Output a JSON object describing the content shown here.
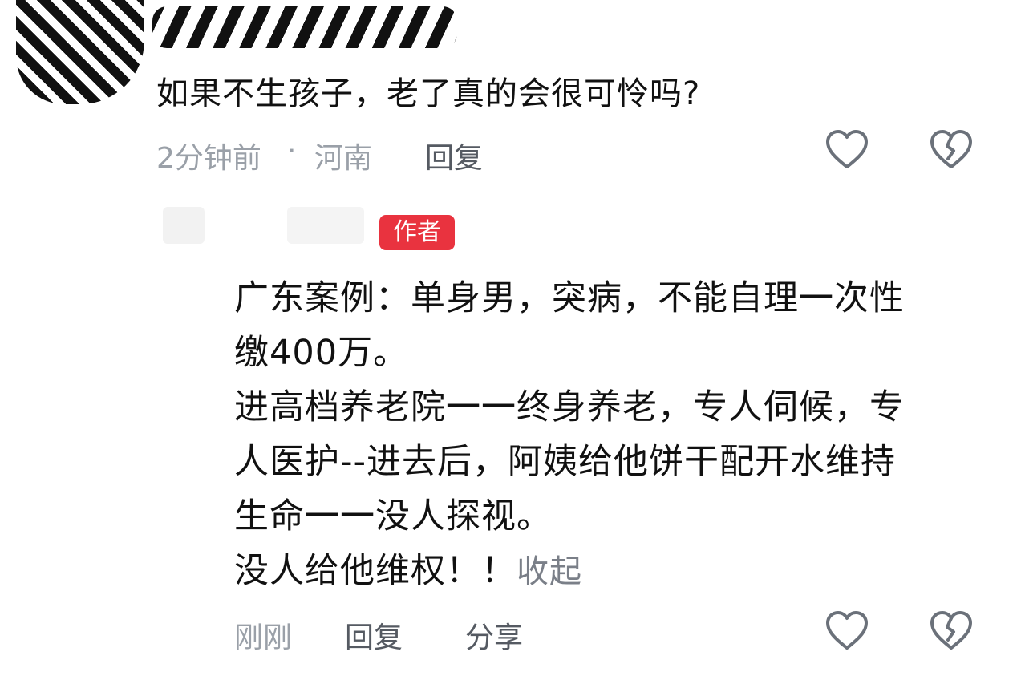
{
  "comment": {
    "text": "如果不生孩子，老了真的会很可怜吗?",
    "time": "2分钟前",
    "separator": "·",
    "location": "河南",
    "reply_label": "回复",
    "icons": [
      "heart-outline-icon",
      "broken-heart-icon"
    ]
  },
  "reply": {
    "badge": "作者",
    "lines": [
      "广东案例：单身男，突病，不能自理一次性",
      "缴400万。",
      "进高档养老院一一终身养老，专人伺候，专",
      "人医护--进去后，阿姨给他饼干配开水维持",
      "生命一一没人探视。",
      "没人给他维权！！"
    ],
    "collapse_label": "收起",
    "time": "刚刚",
    "reply_label": "回复",
    "share_label": "分享"
  },
  "colors": {
    "text": "#111111",
    "meta": "#9aa0a8",
    "badge_bg": "#e9333f",
    "icon": "#6b717a"
  }
}
